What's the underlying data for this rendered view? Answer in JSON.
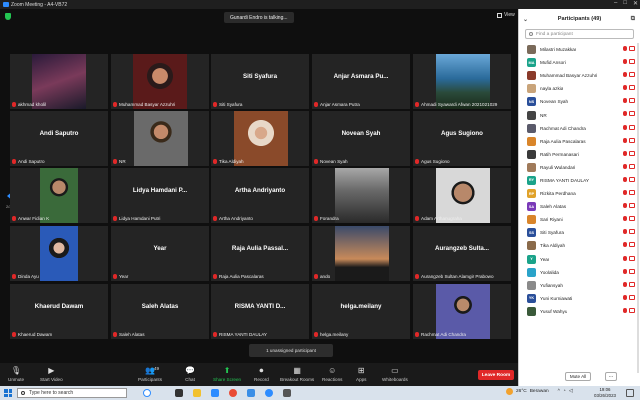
{
  "window": {
    "title": "Zoom Meeting - A4-VB72",
    "controls": [
      "–",
      "□",
      "✕"
    ]
  },
  "meeting": {
    "talking_banner": "Gunardi Endro is talking...",
    "view_label": "View",
    "pager_left": "2/2",
    "pager_right": "2/2",
    "unassigned": "1 unassigned participant"
  },
  "tiles": [
    {
      "label": "akhmad kholil",
      "name": "",
      "photo": "anime"
    },
    {
      "label": "Muhammad Basyar Azzuhri",
      "name": "",
      "photo": "man-red"
    },
    {
      "label": "Siti Syafura",
      "name": "Siti Syafura",
      "photo": ""
    },
    {
      "label": "Anjar Asmara Putra",
      "name": "Anjar Asmara Pu...",
      "photo": ""
    },
    {
      "label": "Ahmadi Syawardi Afwan 2021021029",
      "name": "",
      "photo": "beach"
    },
    {
      "label": "Andi Saputro",
      "name": "Andi Saputro",
      "photo": ""
    },
    {
      "label": "NR",
      "name": "",
      "photo": "man-glasses"
    },
    {
      "label": "Tika Aldiyah",
      "name": "",
      "photo": "woman-hijab"
    },
    {
      "label": "Novean Syah",
      "name": "Novean Syah",
      "photo": ""
    },
    {
      "label": "Agus Sugiono",
      "name": "Agus Sugiono",
      "photo": ""
    },
    {
      "label": "Anwar Fidian K",
      "name": "",
      "photo": "man-green"
    },
    {
      "label": "Lidya Hamdani Putri",
      "name": "Lidya Hamdani P...",
      "photo": ""
    },
    {
      "label": "Artha Andriyanto",
      "name": "Artha Andriyanto",
      "photo": ""
    },
    {
      "label": "Forandra",
      "name": "",
      "photo": "man-suit"
    },
    {
      "label": "Adam Arthanugraha",
      "name": "",
      "photo": "man-face"
    },
    {
      "label": "Dinda Ayu",
      "name": "",
      "photo": "woman-blue"
    },
    {
      "label": "Year",
      "name": "Year",
      "photo": ""
    },
    {
      "label": "Raja Aulia Pascalaras",
      "name": "Raja Aulia Passal...",
      "photo": ""
    },
    {
      "label": "ando",
      "name": "",
      "photo": "sunset"
    },
    {
      "label": "Aurangzeb Sultan Alamgir Prabowo",
      "name": "Aurangzeb Sulta...",
      "photo": ""
    },
    {
      "label": "Khaerud Dawam",
      "name": "Khaerud Dawam",
      "photo": ""
    },
    {
      "label": "Saleh Alatas",
      "name": "Saleh Alatas",
      "photo": ""
    },
    {
      "label": "RISMA YANTI DAULAY",
      "name": "RISMA YANTI D...",
      "photo": ""
    },
    {
      "label": "helga.meilany",
      "name": "helga.meilany",
      "photo": ""
    },
    {
      "label": "Rachmat Adi Chandra",
      "name": "",
      "photo": "man-batik"
    }
  ],
  "toolbar": {
    "unmute": "Unmute",
    "start_video": "Start Video",
    "participants": "Participants",
    "participants_count": "49",
    "chat": "Chat",
    "share_screen": "Share Screen",
    "record": "Record",
    "breakout": "Breakout Rooms",
    "reactions": "Reactions",
    "apps": "Apps",
    "whiteboards": "Whiteboards",
    "leave": "Leave Room"
  },
  "panel": {
    "title": "Participants (49)",
    "search_placeholder": "Find a participant",
    "mute_all": "Mute All",
    "more": "···",
    "participants": [
      {
        "initials": "",
        "name": "Milastri Muzakkar",
        "color": "#7a6a5a"
      },
      {
        "initials": "MA",
        "name": "Mufid Ansori",
        "color": "#1aa38a"
      },
      {
        "initials": "",
        "name": "Muhammad Basyar Azzuhri",
        "color": "#8a3a2a"
      },
      {
        "initials": "",
        "name": "nayla azkia",
        "color": "#c9a47a"
      },
      {
        "initials": "NS",
        "name": "Novean Syah",
        "color": "#2a4f9a"
      },
      {
        "initials": "",
        "name": "NR",
        "color": "#444444"
      },
      {
        "initials": "",
        "name": "Rachmat Adi Chandra",
        "color": "#5a5a6a"
      },
      {
        "initials": "",
        "name": "Raja Aulia Pascalaras",
        "color": "#d9852a"
      },
      {
        "initials": "",
        "name": "Ratih Permanasari",
        "color": "#3a3a3a"
      },
      {
        "initials": "",
        "name": "Rayuli Wulandari",
        "color": "#a07a5a"
      },
      {
        "initials": "RY",
        "name": "RISMA YANTI DAULAY",
        "color": "#1aa38a"
      },
      {
        "initials": "RP",
        "name": "Rizkita Perdhana",
        "color": "#e0a22a"
      },
      {
        "initials": "SA",
        "name": "Saleh Alatas",
        "color": "#7a3ab8"
      },
      {
        "initials": "",
        "name": "Sari Riyani",
        "color": "#d9852a"
      },
      {
        "initials": "SS",
        "name": "Siti Syafura",
        "color": "#2a4f9a"
      },
      {
        "initials": "",
        "name": "Tika Aldiyah",
        "color": "#8a6a4a"
      },
      {
        "initials": "Y",
        "name": "Year",
        "color": "#1aa38a"
      },
      {
        "initials": "",
        "name": "Yoolalida",
        "color": "#2aa3c9"
      },
      {
        "initials": "",
        "name": "Yufiansyah",
        "color": "#8a8a8a"
      },
      {
        "initials": "YK",
        "name": "Yuni Kurniawati",
        "color": "#2a4f9a"
      },
      {
        "initials": "",
        "name": "Yusuf Wahyu",
        "color": "#3a5a3a"
      }
    ]
  },
  "taskbar": {
    "search_placeholder": "Type here to search",
    "weather": "26°C",
    "weather_desc": "Berawan",
    "time": "19:06",
    "date": "03/26/2023"
  }
}
